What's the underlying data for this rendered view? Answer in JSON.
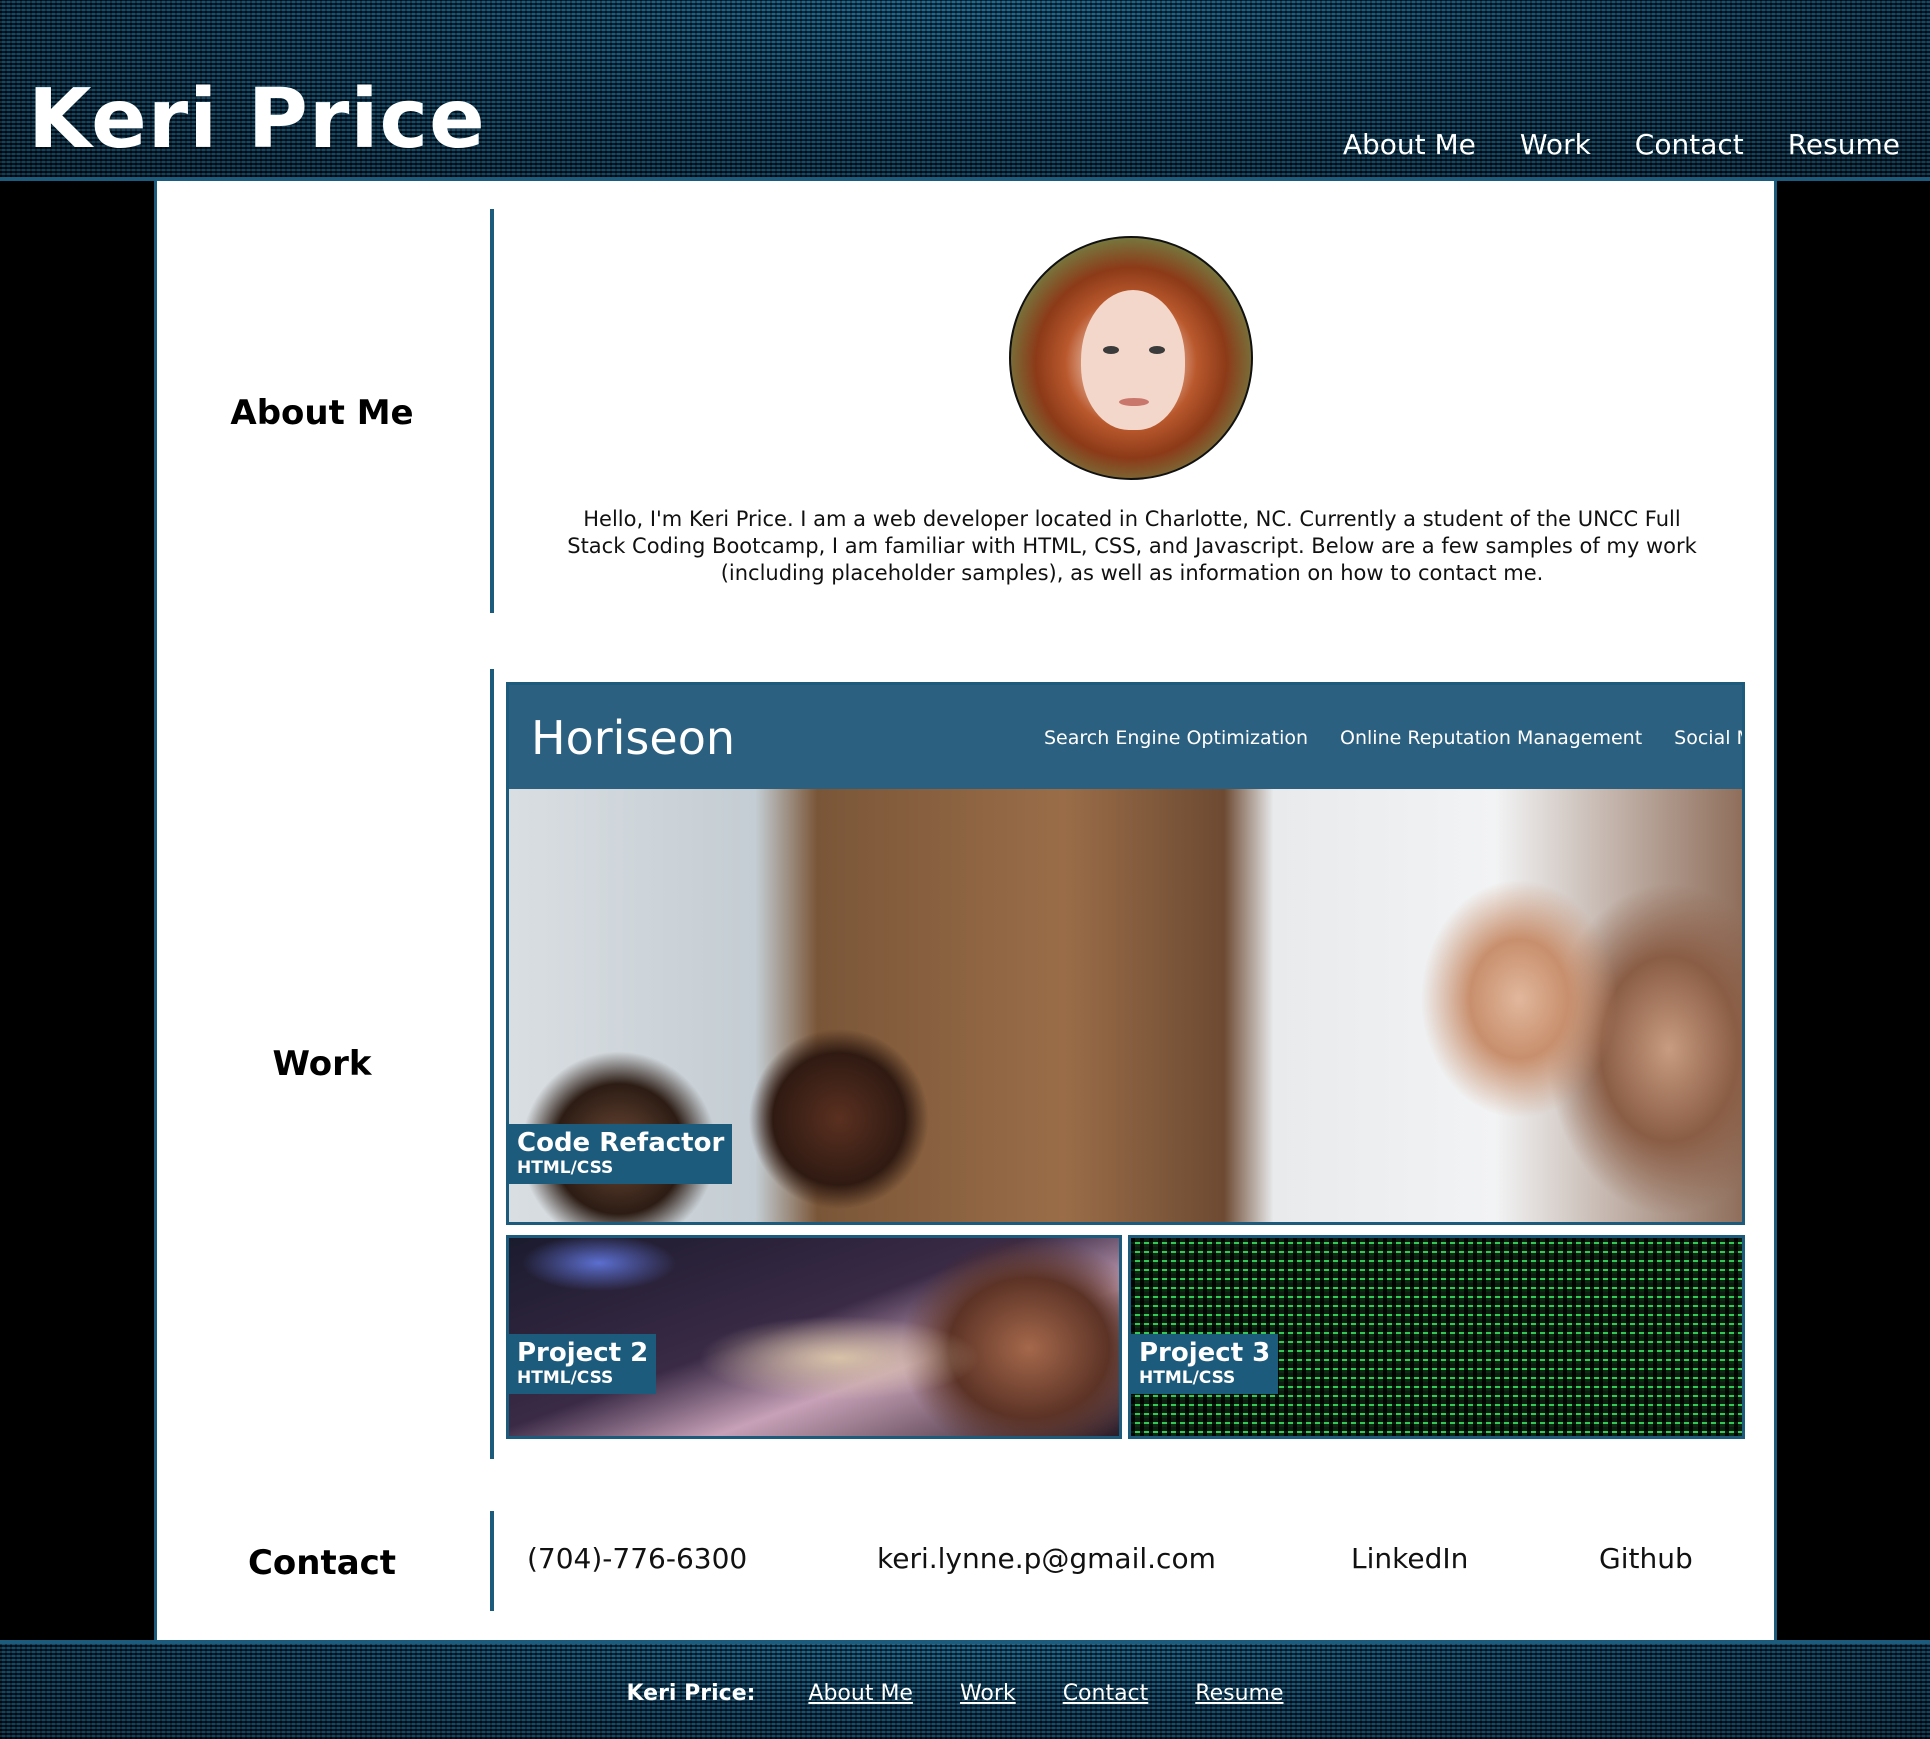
{
  "header": {
    "title": "Keri Price",
    "nav": [
      "About Me",
      "Work",
      "Contact",
      "Resume"
    ]
  },
  "about": {
    "label": "About Me",
    "text": "Hello, I'm Keri Price. I am a web developer located in Charlotte, NC. Currently a student of the UNCC Full Stack Coding Bootcamp, I am familiar with HTML, CSS, and Javascript. Below are a few samples of my work (including placeholder samples), as well as information on how to contact me."
  },
  "work": {
    "label": "Work",
    "featured": {
      "mock_logo": "Horiseon",
      "mock_nav": [
        "Search Engine Optimization",
        "Online Reputation Management",
        "Social Media M"
      ],
      "title": "Code Refactor",
      "subtitle": "HTML/CSS"
    },
    "projects": [
      {
        "title": "Project 2",
        "subtitle": "HTML/CSS"
      },
      {
        "title": "Project 3",
        "subtitle": "HTML/CSS"
      }
    ]
  },
  "contact": {
    "label": "Contact",
    "phone": "(704)-776-6300",
    "email": "keri.lynne.p@gmail.com",
    "linkedin": "LinkedIn",
    "github": "Github"
  },
  "footer": {
    "brand": "Keri Price:",
    "nav": [
      "About Me",
      "Work",
      "Contact",
      "Resume"
    ]
  },
  "colors": {
    "accent": "#1d5b7d",
    "background": "#000000",
    "panel": "#ffffff"
  }
}
